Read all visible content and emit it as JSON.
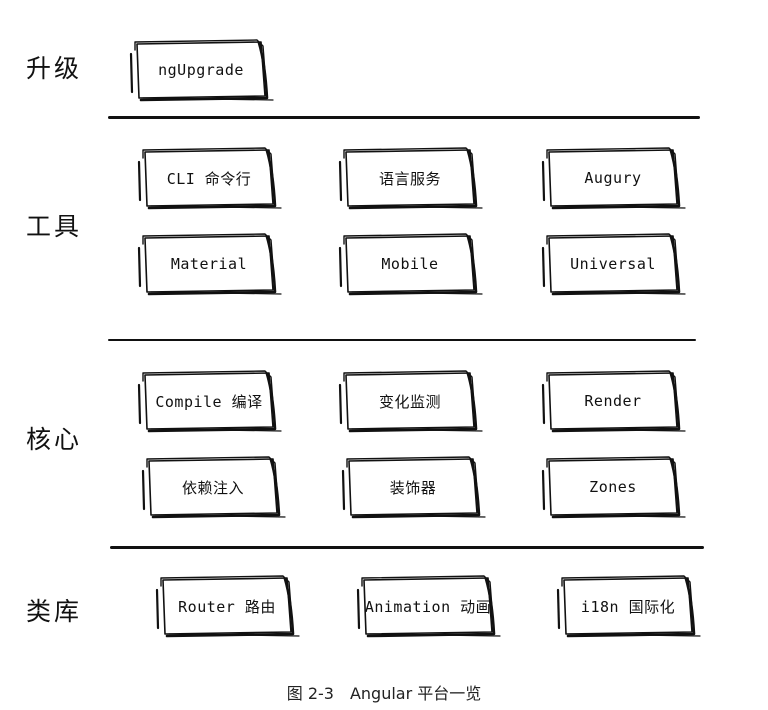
{
  "diagram": {
    "layers": [
      {
        "label": "升级",
        "items": [
          "ngUpgrade"
        ]
      },
      {
        "label": "工具",
        "items": [
          "CLI 命令行",
          "语言服务",
          "Augury",
          "Material",
          "Mobile",
          "Universal"
        ]
      },
      {
        "label": "核心",
        "items": [
          "Compile 编译",
          "变化监测",
          "Render",
          "依赖注入",
          "装饰器",
          "Zones"
        ]
      },
      {
        "label": "类库",
        "items": [
          "Router 路由",
          "Animation 动画",
          "i18n 国际化"
        ]
      }
    ]
  },
  "caption": "图 2-3　Angular 平台一览",
  "colors": {
    "ink": "#111111",
    "background": "#ffffff"
  }
}
